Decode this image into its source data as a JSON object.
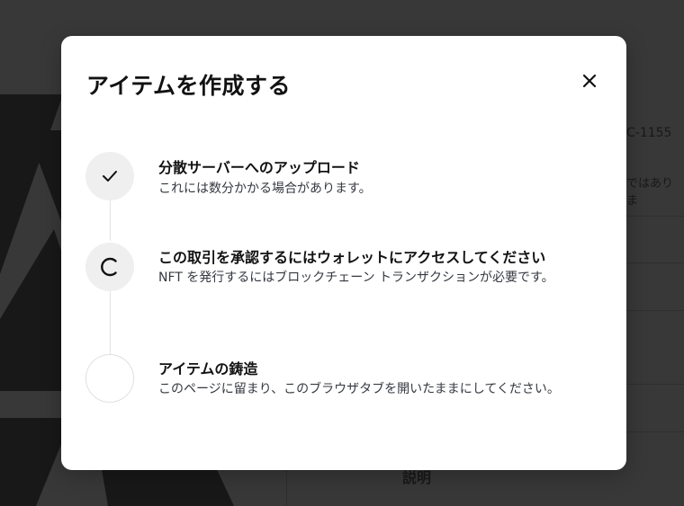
{
  "background": {
    "token_standard_fragment": "C-1155",
    "note_fragment": "ではありま",
    "description_label": "説明"
  },
  "modal": {
    "title": "アイテムを作成する",
    "close_icon": "close-icon",
    "steps": [
      {
        "status": "complete",
        "icon": "check-icon",
        "title": "分散サーバーへのアップロード",
        "description": "これには数分かかる場合があります。"
      },
      {
        "status": "in-progress",
        "icon": "spinner-icon",
        "title": "この取引を承認するにはウォレットにアクセスしてください",
        "description": "NFT を発行するにはブロックチェーン トランザクションが必要です。"
      },
      {
        "status": "pending",
        "icon": "",
        "title": "アイテムの鋳造",
        "description": "このページに留まり、このブラウザタブを開いたままにしてください。"
      }
    ]
  }
}
